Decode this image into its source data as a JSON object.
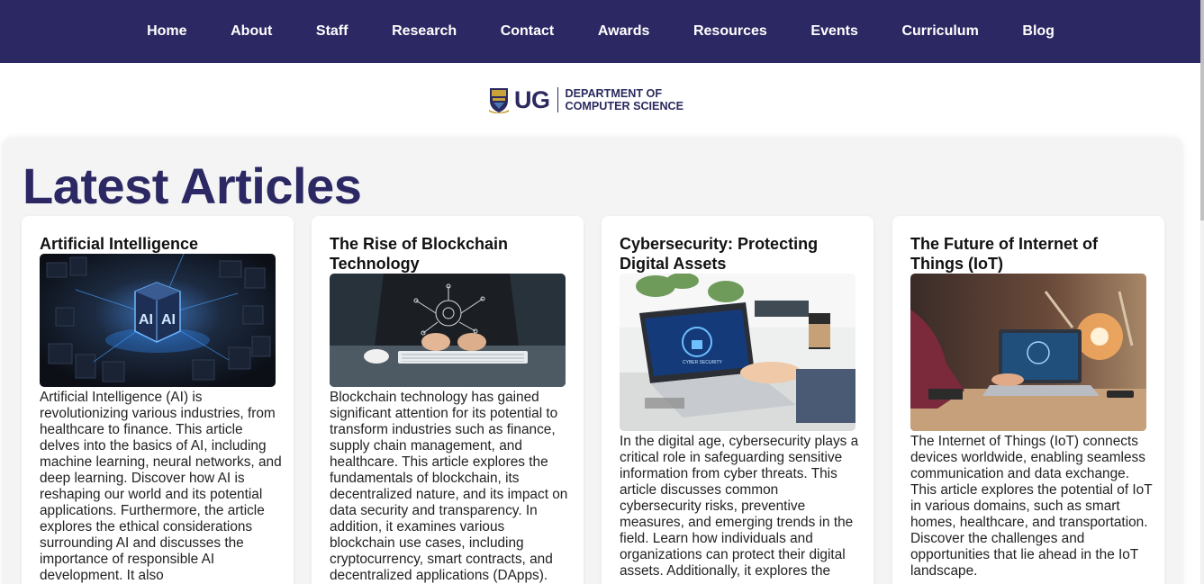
{
  "nav": {
    "items": [
      {
        "label": "Home"
      },
      {
        "label": "About"
      },
      {
        "label": "Staff"
      },
      {
        "label": "Research"
      },
      {
        "label": "Contact"
      },
      {
        "label": "Awards"
      },
      {
        "label": "Resources"
      },
      {
        "label": "Events"
      },
      {
        "label": "Curriculum"
      },
      {
        "label": "Blog"
      }
    ]
  },
  "logo": {
    "abbrev": "UG",
    "line1": "DEPARTMENT OF",
    "line2": "COMPUTER SCIENCE"
  },
  "section": {
    "title": "Latest Articles"
  },
  "articles": [
    {
      "title": "Artificial Intelligence",
      "image": "ai-chip-cube-image",
      "body": "Artificial Intelligence (AI) is revolutionizing various industries, from healthcare to finance. This article delves into the basics of AI, including machine learning, neural networks, and deep learning. Discover how AI is reshaping our world and its potential applications. Furthermore, the article explores the ethical considerations surrounding AI and discusses the importance of responsible AI development. It also"
    },
    {
      "title": "The Rise of Blockchain Technology",
      "image": "laptop-keyboard-image",
      "body": "Blockchain technology has gained significant attention for its potential to transform industries such as finance, supply chain management, and healthcare. This article explores the fundamentals of blockchain, its decentralized nature, and its impact on data security and transparency. In addition, it examines various blockchain use cases, including cryptocurrency, smart contracts, and decentralized applications (DApps)."
    },
    {
      "title": "Cybersecurity: Protecting Digital Assets",
      "image": "cyber-security-laptop-image",
      "body": "In the digital age, cybersecurity plays a critical role in safeguarding sensitive information from cyber threats. This article discusses common cybersecurity risks, preventive measures, and emerging trends in the field. Learn how individuals and organizations can protect their digital assets. Additionally, it explores the"
    },
    {
      "title": "The Future of Internet of Things (IoT)",
      "image": "iot-factory-laptop-image",
      "body": "The Internet of Things (IoT) connects devices worldwide, enabling seamless communication and data exchange. This article explores the potential of IoT in various domains, such as smart homes, healthcare, and transportation. Discover the challenges and opportunities that lie ahead in the IoT landscape."
    }
  ],
  "colors": {
    "navbar": "#2c2863",
    "heading": "#2c2863",
    "section_bg": "#f4f4f4",
    "card_bg": "#ffffff"
  }
}
